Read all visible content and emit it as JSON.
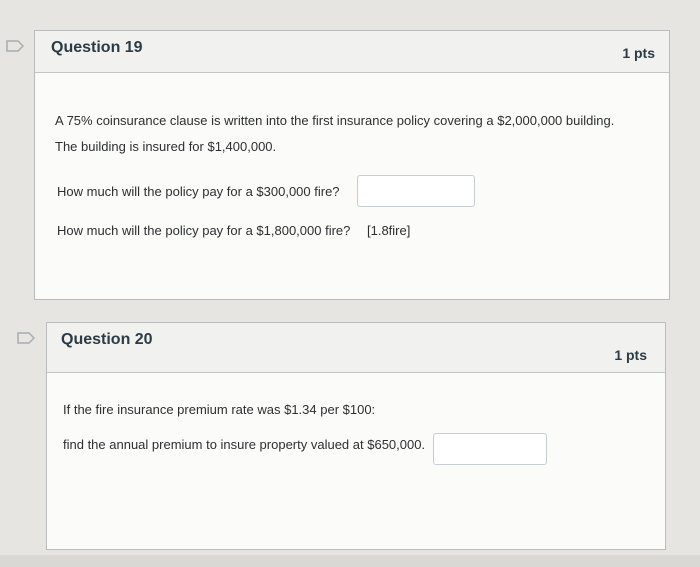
{
  "questions": [
    {
      "title": "Question 19",
      "points": "1 pts",
      "flag_icon": "bookmark-flag-icon",
      "text_line1": "A 75% coinsurance clause is written into the first insurance policy covering a $2,000,000 building.",
      "text_line2": "The building is insured for $1,400,000.",
      "prompt1": "How much will the policy pay for a $300,000 fire?",
      "answer1_value": "",
      "prompt2": "How much will the policy pay for a $1,800,000 fire?",
      "answer2_dropdown_value": "[1.8fire]"
    },
    {
      "title": "Question 20",
      "points": "1 pts",
      "flag_icon": "bookmark-flag-icon",
      "prompt1": "If the fire insurance premium rate was $1.34 per $100:",
      "prompt2": "find the annual premium to insure property valued at $650,000.",
      "answer_value": ""
    }
  ],
  "colors": {
    "header_bg": "#f1f1f0",
    "card_bg": "#fbfbfa",
    "border": "#b9bbbd",
    "page_bg": "#e6e5e1"
  }
}
